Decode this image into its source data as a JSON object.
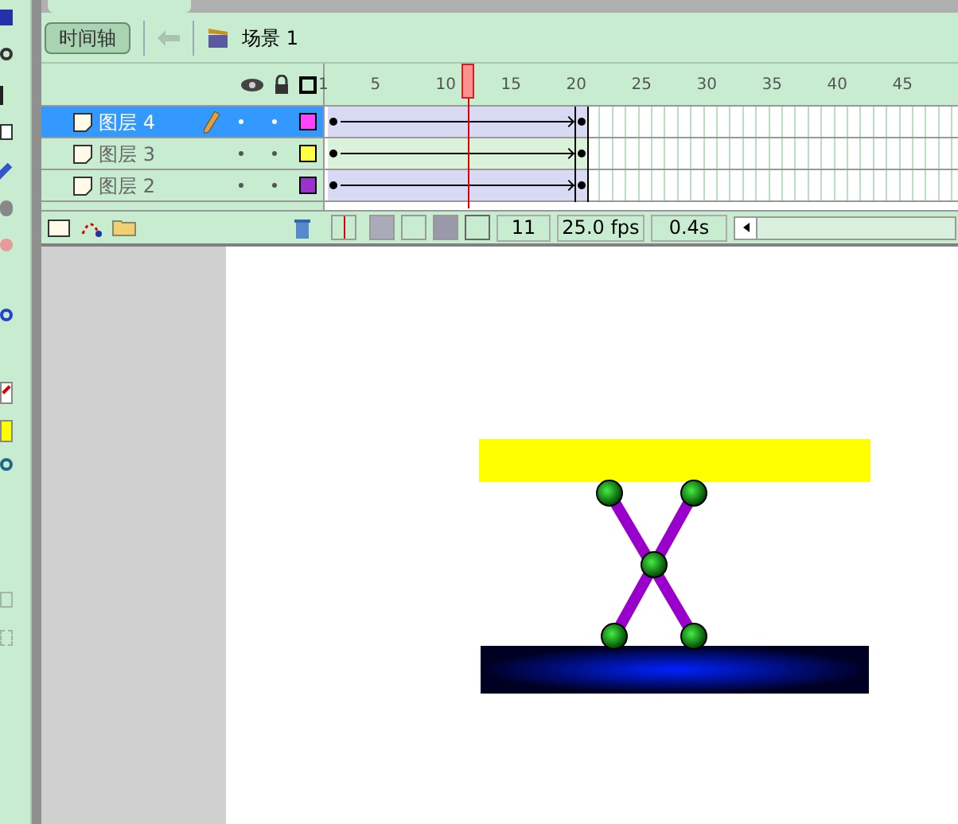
{
  "timeline_button": {
    "label": "时间轴",
    "selected": true
  },
  "scene": {
    "label": "场景 1"
  },
  "ruler": {
    "labels": [
      "1",
      "5",
      "10",
      "15",
      "20",
      "25",
      "30",
      "35",
      "40",
      "45"
    ]
  },
  "layers": [
    {
      "name": "图层 4",
      "selected": true,
      "editing": true,
      "color": "#ff44ff"
    },
    {
      "name": "图层 3",
      "selected": false,
      "editing": false,
      "color": "#ffff44"
    },
    {
      "name": "图层 2",
      "selected": false,
      "editing": false,
      "color": "#9933cc"
    }
  ],
  "status": {
    "current_frame": "11",
    "frame_rate": "25.0 fps",
    "elapsed_time": "0.4s"
  }
}
